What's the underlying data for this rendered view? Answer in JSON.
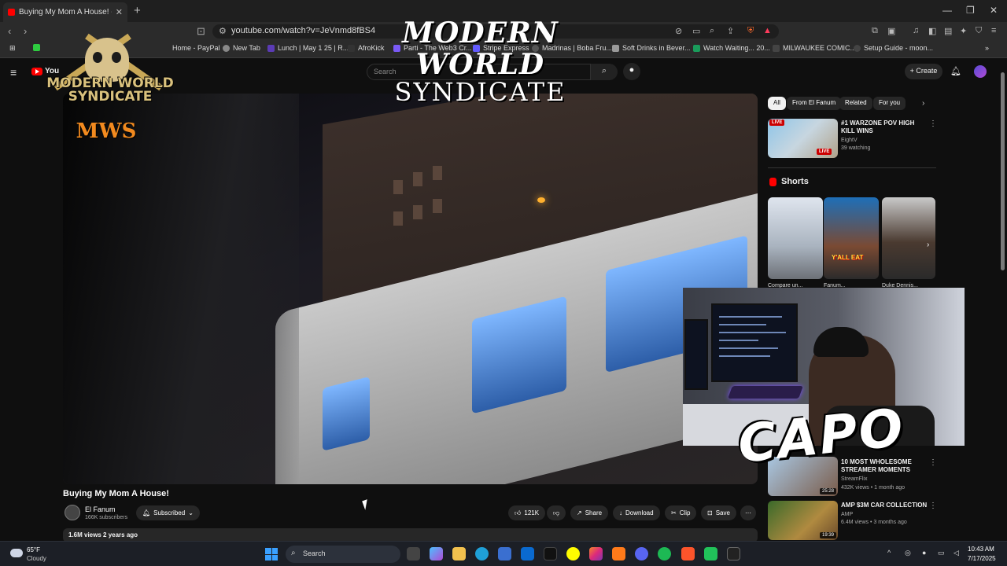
{
  "browser": {
    "tab_title": "Buying My Mom A House! - Y",
    "tab_close": "✕",
    "new_tab": "+",
    "url": "youtube.com/watch?v=JeVnmd8fBS4",
    "window_controls": [
      "—",
      "❐",
      "✕"
    ]
  },
  "bookmarks": [
    {
      "label": "Home - PayPal",
      "color": "#1f7cd0"
    },
    {
      "label": "New Tab",
      "color": "#888888"
    },
    {
      "label": "Lunch | May 1 25 | R...",
      "color": "#5b3bb5"
    },
    {
      "label": "AfroKick",
      "color": "#333333"
    },
    {
      "label": "Parti - The Web3 Cr...",
      "color": "#7a5af5"
    },
    {
      "label": "Stripe Express",
      "color": "#635bff"
    },
    {
      "label": "Madrinas | Boba Fru...",
      "color": "#555555"
    },
    {
      "label": "Soft Drinks in Bever...",
      "color": "#999999"
    },
    {
      "label": "Watch Waiting... 20...",
      "color": "#1a9c5b"
    },
    {
      "label": "MILWAUKEE COMIC...",
      "color": "#444444"
    },
    {
      "label": "Setup Guide - moon...",
      "color": "#444444"
    }
  ],
  "youtube": {
    "logo_text": "You",
    "search_placeholder": "Search",
    "create_label": "Create"
  },
  "overlay": {
    "banner_title": "MODERN WORLD",
    "banner_sub": "SYNDICATE",
    "logo_text": "MODERN WORLD SYNDICATE",
    "logo_abbr": "MWS",
    "streamer_name": "CAPO"
  },
  "video": {
    "title": "Buying My Mom A House!",
    "channel": "El Fanum",
    "subscribers": "166K subscribers",
    "subscribed_label": "Subscribed",
    "likes": "121K",
    "share_label": "Share",
    "download_label": "Download",
    "clip_label": "Clip",
    "save_label": "Save",
    "views_age": "1.6M views  2 years ago"
  },
  "sidebar": {
    "chips": [
      "All",
      "From El Fanum",
      "Related",
      "For you"
    ],
    "live_item": {
      "title": "#1 WARZONE POV HIGH KILL WINS",
      "channel": "EightV",
      "meta": "39 watching",
      "badge": "LIVE",
      "badge2": "LIVE"
    },
    "shorts_heading": "Shorts",
    "shorts_labels": [
      "Compare un...",
      "Fanum...",
      "Duke Dennis..."
    ],
    "shorts_overlay_text": "Y'ALL EAT",
    "recs": [
      {
        "title": "10 MOST WHOLESOME STREAMER MOMENTS",
        "channel": "StreamFlix",
        "meta": "432K views • 1 month ago",
        "duration": "25:28"
      },
      {
        "title": "AMP $3M CAR COLLECTION",
        "channel": "AMP",
        "meta": "6.4M views • 3 months ago",
        "duration": "19:39"
      }
    ]
  },
  "taskbar": {
    "temp": "65°F",
    "weather": "Cloudy",
    "search_label": "Search",
    "time": "10:43 AM",
    "date": "7/17/2025"
  }
}
